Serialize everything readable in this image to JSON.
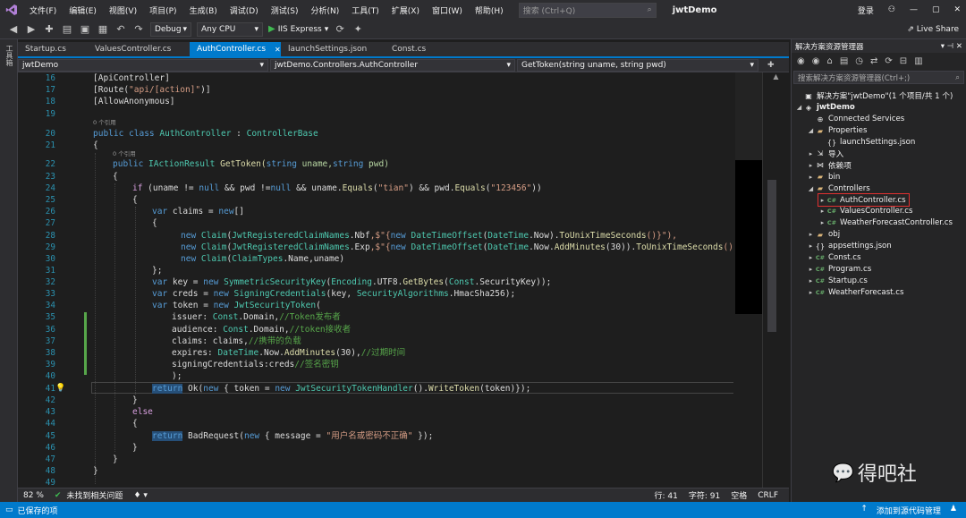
{
  "menu": {
    "items": [
      "文件(F)",
      "编辑(E)",
      "视图(V)",
      "项目(P)",
      "生成(B)",
      "调试(D)",
      "测试(S)",
      "分析(N)",
      "工具(T)",
      "扩展(X)",
      "窗口(W)",
      "帮助(H)"
    ],
    "search_placeholder": "搜索 (Ctrl+Q)",
    "solution_name": "jwtDemo",
    "login": "登录"
  },
  "toolbar": {
    "config": "Debug",
    "platform": "Any CPU",
    "run_label": "IIS Express",
    "live_share": "Live Share"
  },
  "left_strip": {
    "label": "工具箱"
  },
  "tabs": [
    {
      "label": "Startup.cs",
      "active": false
    },
    {
      "label": "ValuesController.cs",
      "active": false
    },
    {
      "label": "AuthController.cs",
      "active": true
    },
    {
      "label": "launchSettings.json",
      "active": false
    },
    {
      "label": "Const.cs",
      "active": false
    }
  ],
  "navbar": {
    "project": "jwtDemo",
    "class": "jwtDemo.Controllers.AuthController",
    "member": "GetToken(string uname, string pwd)"
  },
  "code": {
    "lens_class": "0 个引用",
    "lens_method": "0 个引用",
    "line_numbers": [
      "16",
      "17",
      "18",
      "19",
      "20",
      "21",
      "22",
      "23",
      "24",
      "25",
      "26",
      "27",
      "28",
      "29",
      "30",
      "31",
      "32",
      "33",
      "34",
      "35",
      "36",
      "37",
      "38",
      "39",
      "40",
      "41",
      "42",
      "43",
      "44",
      "45",
      "46",
      "47",
      "48",
      "49"
    ],
    "l16": "[ApiController]",
    "l17a": "[Route(",
    "l17b": "\"api/[action]\"",
    "l17c": ")]",
    "l18": "[AllowAnonymous]",
    "l20a": "public class ",
    "l20b": "AuthController",
    "l20c": " : ",
    "l20d": "ControllerBase",
    "l21": "{",
    "l22a": "public ",
    "l22b": "IActionResult",
    "l22c": " GetToken(",
    "l22d": "string",
    "l22e": " uname,",
    "l22f": "string",
    "l22g": " pwd)",
    "l23": "{",
    "l24a": "if",
    "l24b": " (uname != ",
    "l24c": "null",
    "l24d": " && pwd !=",
    "l24e": "null",
    "l24f": " && uname.",
    "l24g": "Equals",
    "l24h": "(",
    "l24i": "\"tian\"",
    "l24j": ") && pwd.",
    "l24k": "Equals",
    "l24l": "(",
    "l24m": "\"123456\"",
    "l24n": "))",
    "l25": "{",
    "l26a": "var",
    "l26b": " claims = ",
    "l26c": "new",
    "l26d": "[]",
    "l27": "{",
    "l28a": "new ",
    "l28b": "Claim",
    "l28c": "(",
    "l28d": "JwtRegisteredClaimNames",
    "l28e": ".",
    "l28f": "Nbf",
    "l28g": ",$\"{",
    "l28h": "new ",
    "l28i": "DateTimeOffset",
    "l28j": "(",
    "l28k": "DateTime",
    "l28l": ".",
    "l28m": "Now",
    "l28n": ").",
    "l28o": "ToUnixTimeSeconds",
    "l28p": "()}\"),",
    "l29a": "new ",
    "l29b": "Claim",
    "l29c": "(",
    "l29d": "JwtRegisteredClaimNames",
    "l29e": ".",
    "l29f": "Exp",
    "l29g": ",$\"{",
    "l29h": "new ",
    "l29i": "DateTimeOffset",
    "l29j": "(",
    "l29k": "DateTime",
    "l29l": ".",
    "l29m": "Now",
    "l29n": ".",
    "l29o": "AddMinutes",
    "l29p": "(30)).",
    "l29q": "ToUnixTimeSeconds",
    "l29r": "()}\"),",
    "l30a": "new ",
    "l30b": "Claim",
    "l30c": "(",
    "l30d": "ClaimTypes",
    "l30e": ".",
    "l30f": "Name",
    "l30g": ",uname)",
    "l31": "};",
    "l32a": "var",
    "l32b": " key = ",
    "l32c": "new ",
    "l32d": "SymmetricSecurityKey",
    "l32e": "(",
    "l32f": "Encoding",
    "l32g": ".",
    "l32h": "UTF8",
    "l32i": ".",
    "l32j": "GetBytes",
    "l32k": "(",
    "l32l": "Const",
    "l32m": ".",
    "l32n": "SecurityKey",
    "l32o": "));",
    "l33a": "var",
    "l33b": " creds = ",
    "l33c": "new ",
    "l33d": "SigningCredentials",
    "l33e": "(key, ",
    "l33f": "SecurityAlgorithms",
    "l33g": ".",
    "l33h": "HmacSha256",
    "l33i": ");",
    "l34a": "var",
    "l34b": " token = ",
    "l34c": "new ",
    "l34d": "JwtSecurityToken",
    "l34e": "(",
    "l35a": "issuer: ",
    "l35b": "Const",
    "l35c": ".",
    "l35d": "Domain",
    "l35e": ",",
    "l35f": "//Token发布者",
    "l36a": "audience: ",
    "l36b": "Const",
    "l36c": ".",
    "l36d": "Domain",
    "l36e": ",",
    "l36f": "//token接收者",
    "l37a": "claims: claims,",
    "l37b": "//携带的负载",
    "l38a": "expires: ",
    "l38b": "DateTime",
    "l38c": ".",
    "l38d": "Now",
    "l38e": ".",
    "l38f": "AddMinutes",
    "l38g": "(30),",
    "l38h": "//过期时间",
    "l39a": "signingCredentials:creds",
    "l39b": "//签名密钥",
    "l40": ");",
    "l41a": "return",
    "l41b": " Ok(",
    "l41c": "new",
    "l41d": " { token = ",
    "l41e": "new ",
    "l41f": "JwtSecurityTokenHandler",
    "l41g": "().",
    "l41h": "WriteToken",
    "l41i": "(token)});",
    "l42": "}",
    "l43": "else",
    "l44": "{",
    "l45a": "return",
    "l45b": " BadRequest(",
    "l45c": "new",
    "l45d": " { message = ",
    "l45e": "\"用户名或密码不正确\"",
    "l45f": " });",
    "l46": "}",
    "l47": "}",
    "l48": "}",
    "l49": ""
  },
  "editor_status": {
    "zoom": "82 %",
    "issues": "未找到相关问题",
    "line": "行: 41",
    "char": "字符: 91",
    "spaces": "空格",
    "eol": "CRLF"
  },
  "solution_explorer": {
    "title": "解决方案资源管理器",
    "search_placeholder": "搜索解决方案资源管理器(Ctrl+;)",
    "items": [
      {
        "label": "解决方案\"jwtDemo\"(1 个项目/共 1 个)",
        "icon": "solution-icon",
        "level": 0
      },
      {
        "label": "jwtDemo",
        "icon": "project-icon",
        "level": 0,
        "bold": true
      },
      {
        "label": "Connected Services",
        "icon": "connected-services-icon",
        "level": 1
      },
      {
        "label": "Properties",
        "icon": "folder-icon",
        "level": 1
      },
      {
        "label": "launchSettings.json",
        "icon": "json-file-icon",
        "level": 2
      },
      {
        "label": "导入",
        "icon": "import-icon",
        "level": 1
      },
      {
        "label": "依赖项",
        "icon": "dependencies-icon",
        "level": 1
      },
      {
        "label": "bin",
        "icon": "folder-icon",
        "level": 1
      },
      {
        "label": "Controllers",
        "icon": "folder-icon",
        "level": 1
      },
      {
        "label": "AuthController.cs",
        "icon": "cs-file-icon",
        "level": 2,
        "selected": true
      },
      {
        "label": "ValuesController.cs",
        "icon": "cs-file-icon",
        "level": 2
      },
      {
        "label": "WeatherForecastController.cs",
        "icon": "cs-file-icon",
        "level": 2
      },
      {
        "label": "obj",
        "icon": "folder-icon",
        "level": 1
      },
      {
        "label": "appsettings.json",
        "icon": "json-file-icon",
        "level": 1
      },
      {
        "label": "Const.cs",
        "icon": "cs-file-icon",
        "level": 1
      },
      {
        "label": "Program.cs",
        "icon": "cs-file-icon",
        "level": 1
      },
      {
        "label": "Startup.cs",
        "icon": "cs-file-icon",
        "level": 1
      },
      {
        "label": "WeatherForecast.cs",
        "icon": "cs-file-icon",
        "level": 1
      }
    ]
  },
  "watermark": "得吧社",
  "status": {
    "left": "已保存的项",
    "right": "添加到源代码管理"
  },
  "colors": {
    "accent": "#007acc",
    "selection_outline": "#e03030"
  }
}
